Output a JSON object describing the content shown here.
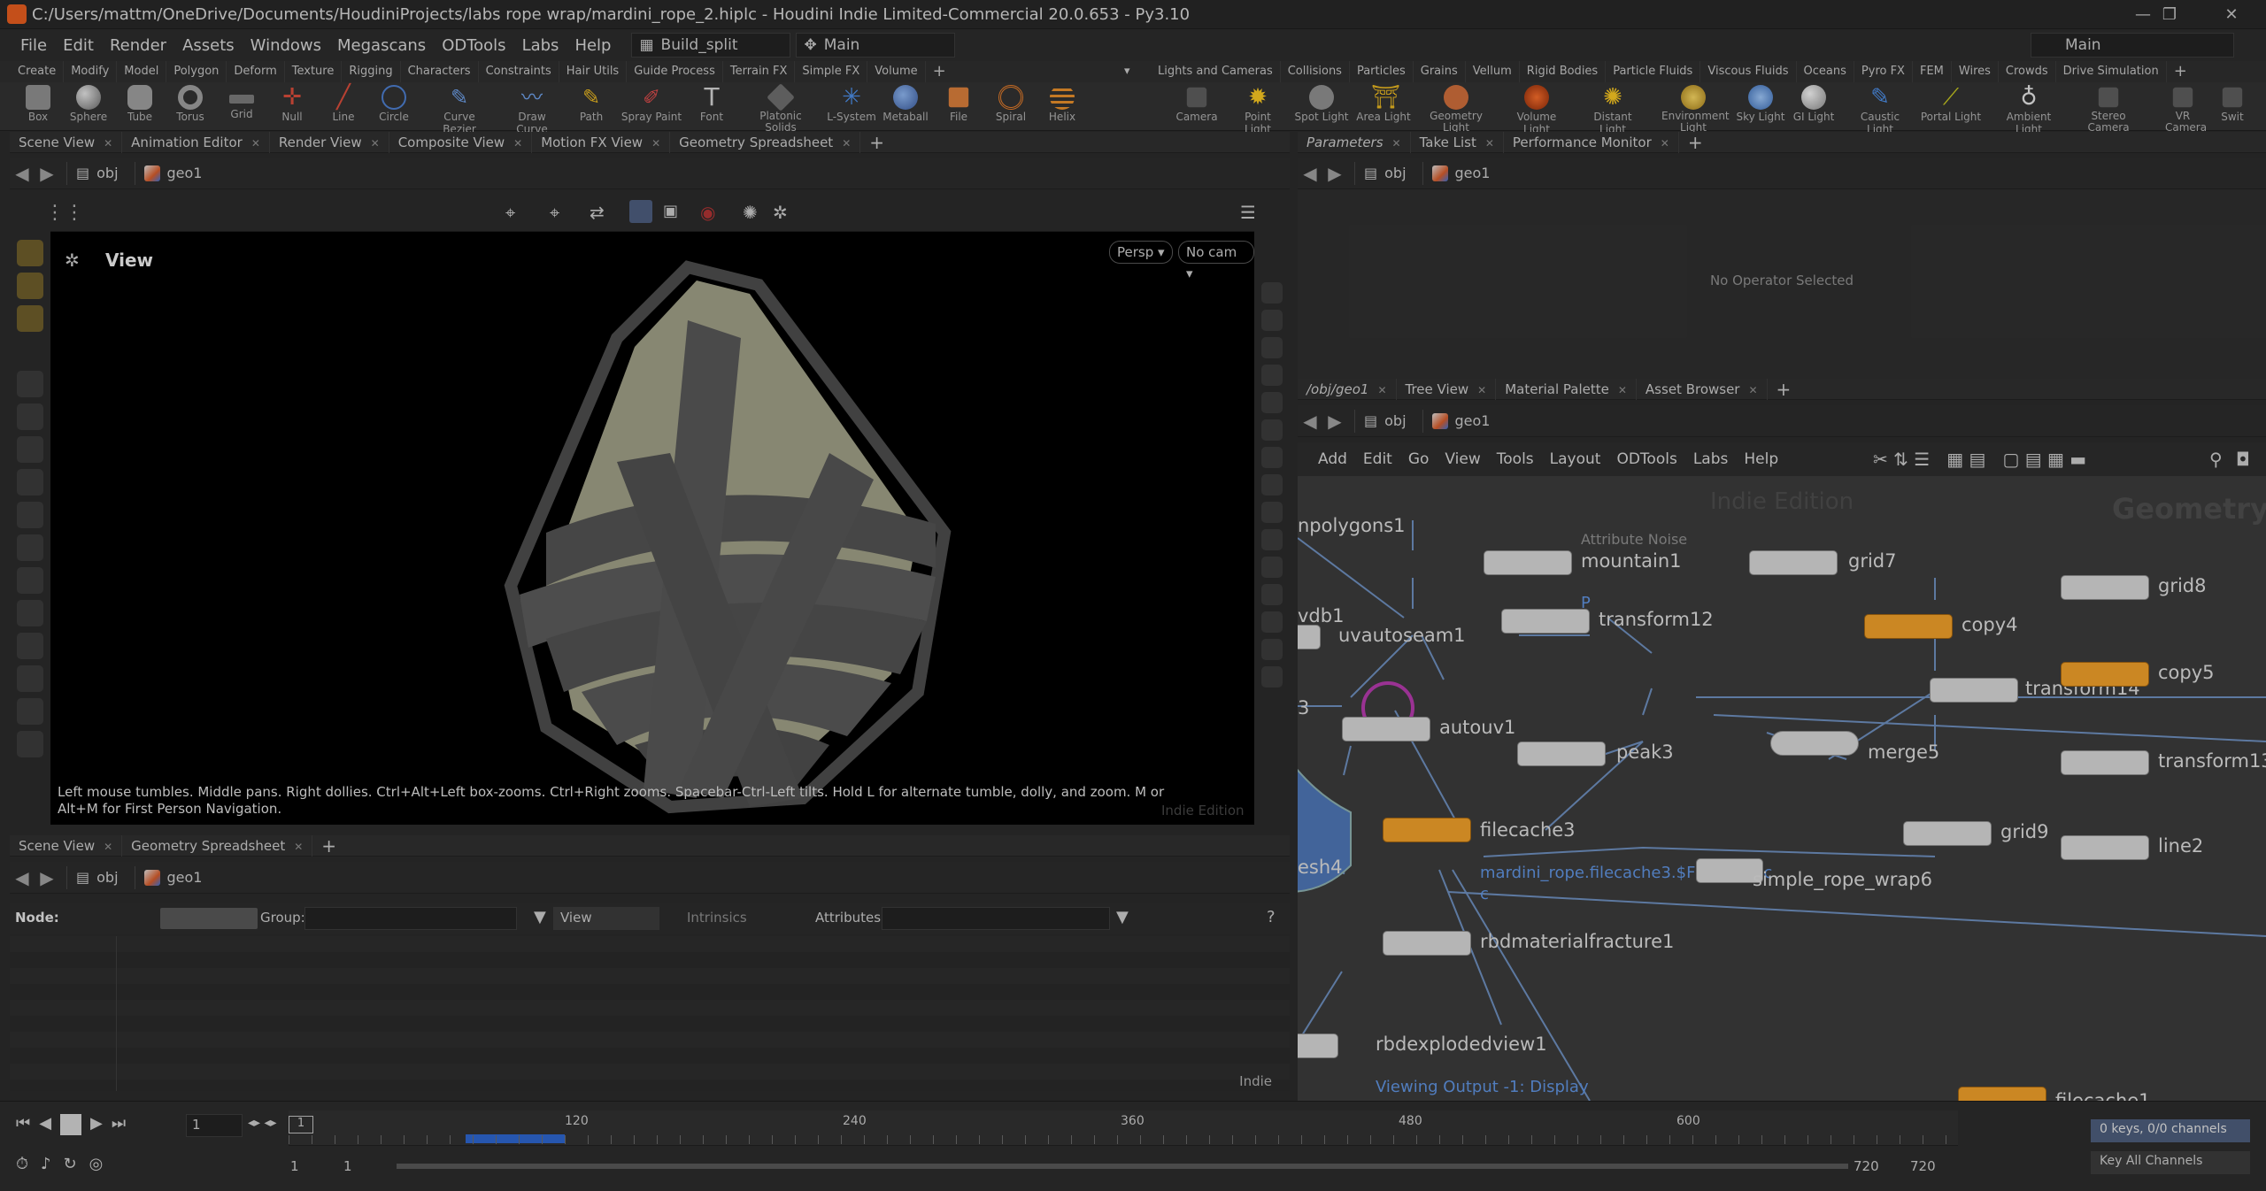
{
  "window": {
    "title": "C:/Users/mattm/OneDrive/Documents/HoudiniProjects/labs rope wrap/mardini_rope_2.hiplc - Houdini Indie Limited-Commercial 20.0.653 - Py3.10"
  },
  "menubar": {
    "items": [
      "File",
      "Edit",
      "Render",
      "Assets",
      "Windows",
      "Megascans",
      "ODTools",
      "Labs",
      "Help"
    ],
    "desktop": "Build_split",
    "main": "Main",
    "right_main": "Main"
  },
  "shelf_tabs_left": [
    "Create",
    "Modify",
    "Model",
    "Polygon",
    "Deform",
    "Texture",
    "Rigging",
    "Characters",
    "Constraints",
    "Hair Utils",
    "Guide Process",
    "Terrain FX",
    "Simple FX",
    "Volume"
  ],
  "shelf_tabs_right": [
    "Lights and Cameras",
    "Collisions",
    "Particles",
    "Grains",
    "Vellum",
    "Rigid Bodies",
    "Particle Fluids",
    "Viscous Fluids",
    "Oceans",
    "Pyro FX",
    "FEM",
    "Wires",
    "Crowds",
    "Drive Simulation"
  ],
  "tools_left": [
    "Box",
    "Sphere",
    "Tube",
    "Torus",
    "Grid",
    "Null",
    "Line",
    "Circle",
    "Curve Bezier",
    "Draw Curve",
    "Path",
    "Spray Paint",
    "Font",
    "Platonic Solids",
    "L-System",
    "Metaball",
    "File",
    "Spiral",
    "Helix"
  ],
  "tools_right": [
    "Camera",
    "Point Light",
    "Spot Light",
    "Area Light",
    "Geometry Light",
    "Volume Light",
    "Distant Light",
    "Environment Light",
    "Sky Light",
    "GI Light",
    "Caustic Light",
    "Portal Light",
    "Ambient Light",
    "Stereo Camera",
    "VR Camera",
    "Swit"
  ],
  "left_tabs": [
    "Scene View",
    "Animation Editor",
    "Render View",
    "Composite View",
    "Motion FX View",
    "Geometry Spreadsheet"
  ],
  "path": {
    "obj": "obj",
    "geo": "geo1"
  },
  "viewport": {
    "label": "View",
    "persp": "Persp ▾",
    "cam": "No cam ▾",
    "help": "Left mouse tumbles. Middle pans. Right dollies. Ctrl+Alt+Left box-zooms. Ctrl+Right zooms. Spacebar-Ctrl-Left tilts. Hold L for alternate tumble, dolly, and zoom. M or Alt+M for First Person Navigation.",
    "watermark": "Indie Edition"
  },
  "lower_tabs": [
    "Scene View",
    "Geometry Spreadsheet"
  ],
  "spreadsheet": {
    "node_label": "Node:",
    "group_label": "Group:",
    "view": "View",
    "intrinsics": "Intrinsics",
    "attributes_label": "Attributes:",
    "indie": "Indie"
  },
  "right_tabs": [
    "Parameters",
    "Take List",
    "Performance Monitor"
  ],
  "parameters": {
    "empty": "No Operator Selected"
  },
  "net_tabs": [
    "/obj/geo1",
    "Tree View",
    "Material Palette",
    "Asset Browser"
  ],
  "net_menu": [
    "Add",
    "Edit",
    "Go",
    "View",
    "Tools",
    "Layout",
    "ODTools",
    "Labs",
    "Help"
  ],
  "network": {
    "watermark": "Indie Edition",
    "context": "Geometry",
    "viewing": "Viewing Output -1: Display",
    "labels": {
      "npolygons": "npolygons1",
      "vdb": "vdb1",
      "n3": "3",
      "esh": "esh4",
      "attr_noise": "Attribute Noise",
      "mountain": "mountain1",
      "p": "P",
      "uvautoseam": "uvautoseam1",
      "transform12": "transform12",
      "autouv": "autouv1",
      "peak": "peak3",
      "filecache3": "filecache3",
      "filecache_path": "mardini_rope.filecache3.$F4.bgeo.sc",
      "c": "c",
      "rbd": "rbdmaterialfracture1",
      "explode": "rbdexplodedview1",
      "grid7": "grid7",
      "copy4": "copy4",
      "transform14": "transform14",
      "merge5": "merge5",
      "grid9": "grid9",
      "rope": "simple_rope_wrap6",
      "grid8": "grid8",
      "copy5": "copy5",
      "transform13": "transform13",
      "line2": "line2",
      "filecache1": "filecache1"
    }
  },
  "timeline": {
    "ticks": [
      "120",
      "240",
      "360",
      "480",
      "600"
    ],
    "frame": "1",
    "start": "1",
    "start2": "1",
    "end": "720",
    "end2": "720",
    "keys": "0 keys, 0/0 channels",
    "keyall": "Key All Channels",
    "cursor": "1"
  }
}
